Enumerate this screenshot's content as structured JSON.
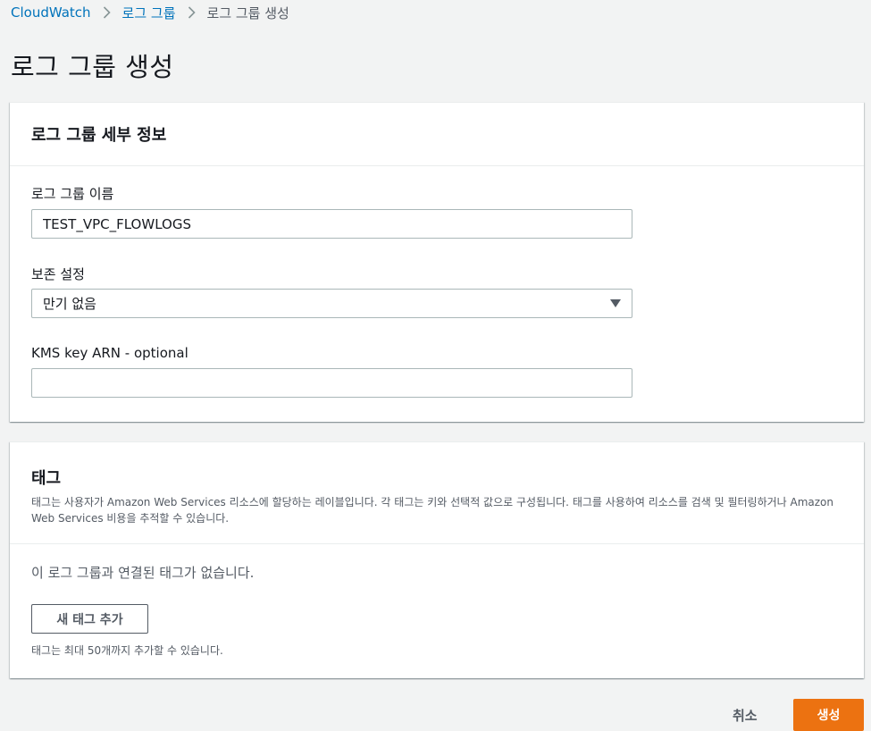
{
  "breadcrumb": {
    "items": [
      {
        "label": "CloudWatch"
      },
      {
        "label": "로그 그룹"
      },
      {
        "label": "로그 그룹 생성"
      }
    ]
  },
  "page_title": "로그 그룹 생성",
  "details_panel": {
    "title": "로그 그룹 세부 정보",
    "log_group_name": {
      "label": "로그 그룹 이름",
      "value": "TEST_VPC_FLOWLOGS"
    },
    "retention": {
      "label": "보존 설정",
      "selected": "만기 없음"
    },
    "kms": {
      "label": "KMS key ARN - optional",
      "value": ""
    }
  },
  "tags_panel": {
    "title": "태그",
    "description": "태그는 사용자가 Amazon Web Services 리소스에 할당하는 레이블입니다. 각 태그는 키와 선택적 값으로 구성됩니다. 태그를 사용하여 리소스를 검색 및 필터링하거나 Amazon Web Services 비용을 추적할 수 있습니다.",
    "empty_message": "이 로그 그룹과 연결된 태그가 없습니다.",
    "add_button": "새 태그 추가",
    "limit_hint": "태그는 최대 50개까지 추가할 수 있습니다."
  },
  "footer": {
    "cancel": "취소",
    "create": "생성"
  },
  "colors": {
    "link": "#0073bb",
    "primary": "#ec7211",
    "background": "#f2f3f3"
  }
}
